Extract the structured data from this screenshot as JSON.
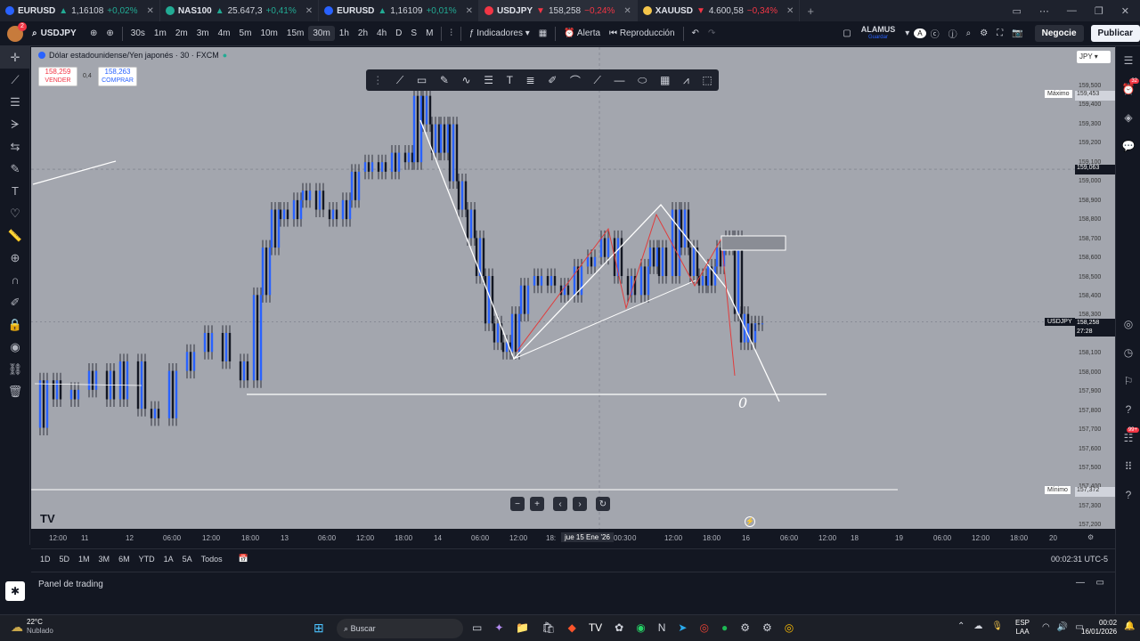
{
  "tabs": [
    {
      "symbol": "EURUSD",
      "price": "1,16108",
      "change": "+0,02%",
      "dir": "up",
      "active": false
    },
    {
      "symbol": "NAS100",
      "price": "25.647,3",
      "change": "+0,41%",
      "dir": "up",
      "active": false
    },
    {
      "symbol": "EURUSD",
      "price": "1,16109",
      "change": "+0,01%",
      "dir": "up",
      "active": false
    },
    {
      "symbol": "USDJPY",
      "price": "158,258",
      "change": "−0,24%",
      "dir": "down",
      "active": true
    },
    {
      "symbol": "XAUUSD",
      "price": "4.600,58",
      "change": "−0,34%",
      "dir": "down",
      "active": false
    }
  ],
  "topbar": {
    "avatar_badge": "2",
    "symbol": "USDJPY",
    "intervals": [
      "30s",
      "1m",
      "2m",
      "3m",
      "4m",
      "5m",
      "10m",
      "15m",
      "30m",
      "1h",
      "2h",
      "4h",
      "D",
      "S",
      "M"
    ],
    "active_interval": "30m",
    "indicators_label": "Indicadores",
    "alert_label": "Alerta",
    "replay_label": "Reproducción",
    "layout_name": "ALAMUS",
    "layout_sub": "Guardar",
    "trade_label": "Negocie",
    "publish_label": "Publicar"
  },
  "chart": {
    "title": "Dólar estadounidense/Yen japonés · 30 · FXCM",
    "sell_price": "158,259",
    "sell_label": "VENDER",
    "spread": "0,4",
    "buy_price": "158,263",
    "buy_label": "COMPRAR",
    "currency": "JPY",
    "max_label": "Máximo",
    "max_price": "159,453",
    "min_label": "Mínimo",
    "min_price": "157,372",
    "crosshair_price": "159,063",
    "current_symbol": "USDJPY",
    "current_price": "158,258",
    "countdown": "27:28",
    "annotation": "0"
  },
  "price_ticks": [
    "159,500",
    "159,400",
    "159,300",
    "159,200",
    "159,100",
    "159,000",
    "158,900",
    "158,800",
    "158,700",
    "158,600",
    "158,500",
    "158,400",
    "158,300",
    "158,200",
    "158,100",
    "158,000",
    "157,900",
    "157,800",
    "157,700",
    "157,600",
    "157,500",
    "157,400",
    "157,300",
    "157,200"
  ],
  "time_ticks": [
    "12:00",
    "11",
    "12",
    "06:00",
    "12:00",
    "18:00",
    "13",
    "06:00",
    "12:00",
    "18:00",
    "14",
    "06:00",
    "12:00",
    "18:",
    "00:30",
    "0",
    "12:00",
    "18:00",
    "16",
    "06:00",
    "12:00",
    "18",
    "19",
    "06:00",
    "12:00",
    "18:00",
    "20"
  ],
  "time_cursor": "jue 15 Ene '26",
  "ranges": [
    "1D",
    "5D",
    "1M",
    "3M",
    "6M",
    "YTD",
    "1A",
    "5A",
    "Todos"
  ],
  "clock": "00:02:31 UTC-5",
  "panel_title": "Panel de trading",
  "taskbar": {
    "weather_temp": "22°C",
    "weather_desc": "Nublado",
    "search_label": "Buscar",
    "lang": "ESP",
    "lang_sub": "LAA",
    "time": "00:02",
    "date": "16/01/2026"
  },
  "right_badges": {
    "notifications": "32",
    "messages": "99+"
  }
}
